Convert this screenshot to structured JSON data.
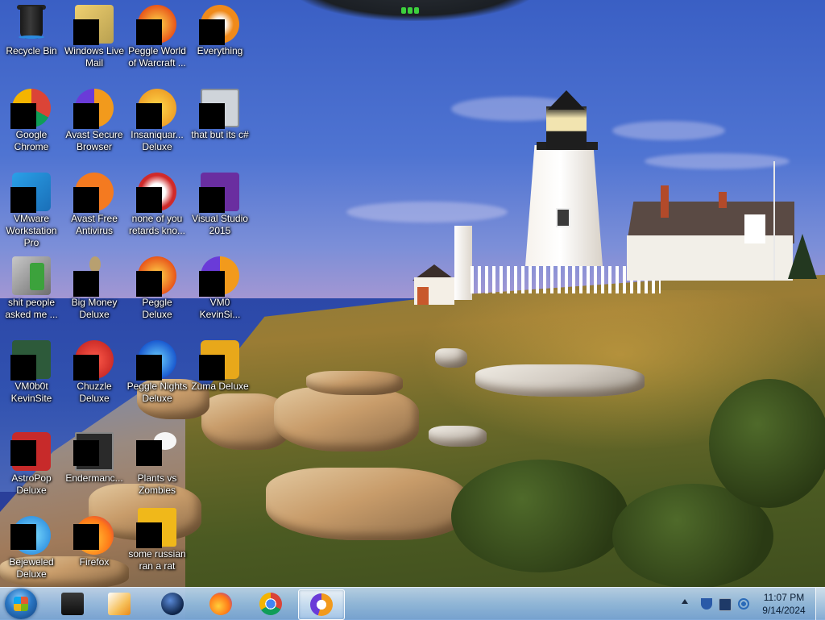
{
  "desktop": {
    "icons": [
      {
        "label": "Recycle Bin",
        "icon": "recycle-bin-icon"
      },
      {
        "label": "Windows Live Mail",
        "icon": "mail-icon"
      },
      {
        "label": "Peggle World of Warcraft ...",
        "icon": "peggle-icon"
      },
      {
        "label": "Everything",
        "icon": "everything-search-icon"
      },
      {
        "label": "Google Chrome",
        "icon": "chrome-icon"
      },
      {
        "label": "Avast Secure Browser",
        "icon": "avast-browser-icon"
      },
      {
        "label": "Insaniquar... Deluxe",
        "icon": "fish-game-icon"
      },
      {
        "label": "that but its c#",
        "icon": "shortcut-icon"
      },
      {
        "label": "VMware Workstation Pro",
        "icon": "vmware-icon"
      },
      {
        "label": "Avast Free Antivirus",
        "icon": "avast-antivirus-icon"
      },
      {
        "label": "none of you retards kno...",
        "icon": "app-icon"
      },
      {
        "label": "Visual Studio 2015",
        "icon": "visual-studio-icon"
      },
      {
        "label": "shit people asked me ...",
        "icon": "folder-icon"
      },
      {
        "label": "Big Money Deluxe",
        "icon": "money-game-icon"
      },
      {
        "label": "Peggle Deluxe",
        "icon": "peggle-icon"
      },
      {
        "label": "VM0 KevinSi...",
        "icon": "app-icon"
      },
      {
        "label": "VM0b0t KevinSite",
        "icon": "app-icon"
      },
      {
        "label": "Chuzzle Deluxe",
        "icon": "chuzzle-icon"
      },
      {
        "label": "Peggle Nights Deluxe",
        "icon": "peggle-icon"
      },
      {
        "label": "Zuma Deluxe",
        "icon": "zuma-icon"
      },
      {
        "label": "AstroPop Deluxe",
        "icon": "astropop-icon"
      },
      {
        "label": "Endermanc...",
        "icon": "app-icon"
      },
      {
        "label": "Plants vs Zombies",
        "icon": "plants-vs-zombies-icon"
      },
      {
        "label": "Bejeweled Deluxe",
        "icon": "bejeweled-icon"
      },
      {
        "label": "Firefox",
        "icon": "firefox-icon"
      },
      {
        "label": "some russian ran a rat",
        "icon": "file-icon"
      }
    ]
  },
  "taskbar": {
    "start": {
      "icon": "windows-start-icon"
    },
    "pinned": [
      {
        "name": "command-prompt",
        "icon": "terminal-icon",
        "color": "#1a1a1a",
        "active": false
      },
      {
        "name": "media-player",
        "icon": "media-player-icon",
        "color": "#f0a030",
        "active": false
      },
      {
        "name": "globe-app",
        "icon": "globe-icon",
        "color": "#1c3a6a",
        "active": false
      },
      {
        "name": "firefox",
        "icon": "firefox-icon",
        "color": "#ff7a18",
        "active": false
      },
      {
        "name": "chrome",
        "icon": "chrome-icon",
        "color": "#e33b2e",
        "active": false
      },
      {
        "name": "avast-secure-browser",
        "icon": "avast-browser-icon",
        "color": "#f29a1c",
        "active": true
      }
    ],
    "tray": {
      "icons": [
        "show-hidden-icons-chevron-icon",
        "shield-icon",
        "network-icon",
        "volume-icon"
      ],
      "time": "11:07 PM",
      "date": "9/14/2024"
    }
  },
  "colors": {
    "taskbar": "#9cc0e6",
    "label_text": "#ffffff"
  }
}
